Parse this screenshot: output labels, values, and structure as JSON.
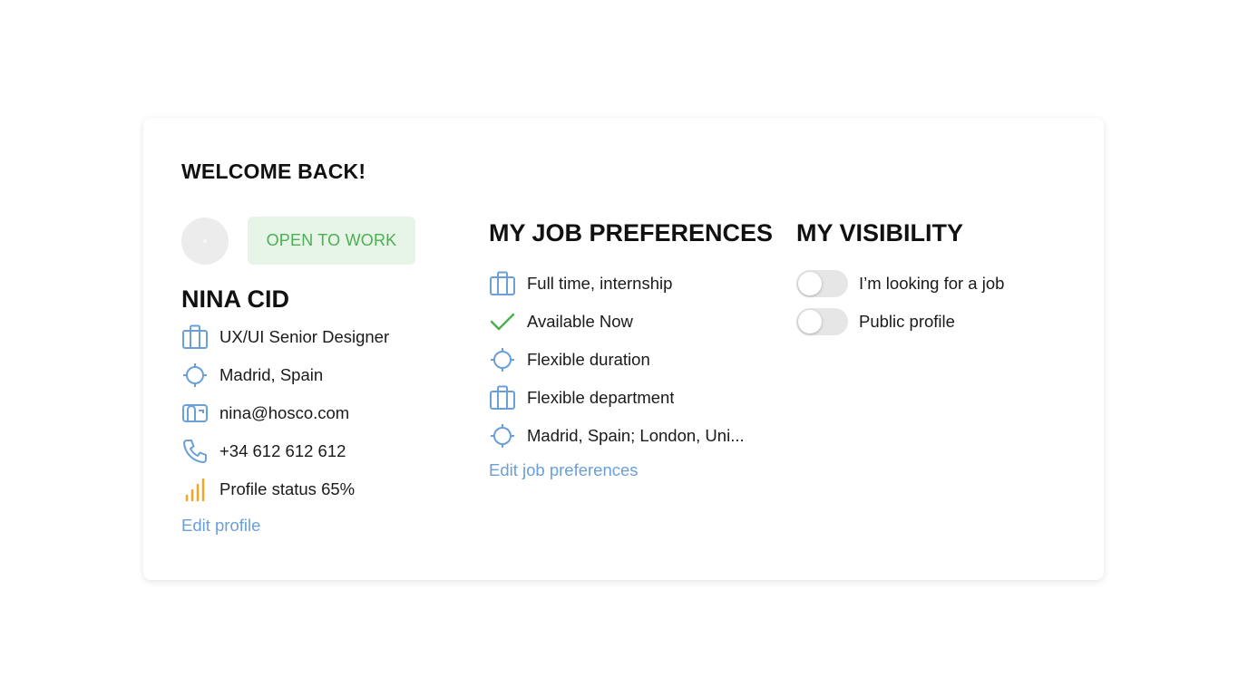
{
  "welcome": "WELCOME BACK!",
  "profile": {
    "badge": "OPEN TO WORK",
    "name": "NINA CID",
    "items": [
      {
        "icon": "briefcase-icon",
        "text": "UX/UI Senior Designer"
      },
      {
        "icon": "location-target-icon",
        "text": "Madrid, Spain"
      },
      {
        "icon": "mailbox-icon",
        "text": "nina@hosco.com"
      },
      {
        "icon": "phone-icon",
        "text": "+34 612 612 612"
      },
      {
        "icon": "signal-bars-icon",
        "text": "Profile status 65%"
      }
    ],
    "edit_link": "Edit profile"
  },
  "job_preferences": {
    "title": "MY JOB PREFERENCES",
    "items": [
      {
        "icon": "briefcase-icon",
        "text": "Full time, internship"
      },
      {
        "icon": "checkmark-icon",
        "text": "Available Now"
      },
      {
        "icon": "location-target-icon",
        "text": "Flexible duration"
      },
      {
        "icon": "briefcase-icon",
        "text": "Flexible department"
      },
      {
        "icon": "location-target-icon",
        "text": "Madrid, Spain; London, Uni..."
      }
    ],
    "edit_link": "Edit job preferences"
  },
  "visibility": {
    "title": "MY VISIBILITY",
    "toggles": [
      {
        "label": "I’m looking for a job",
        "on": false
      },
      {
        "label": "Public profile",
        "on": false
      }
    ]
  },
  "colors": {
    "accent_blue": "#6a9fd8",
    "badge_green_text": "#4caf50",
    "badge_green_bg": "#e6f5e8",
    "check_green": "#4caf50",
    "signal_orange": "#f5a623",
    "toggle_off": "#e6e6e6"
  }
}
